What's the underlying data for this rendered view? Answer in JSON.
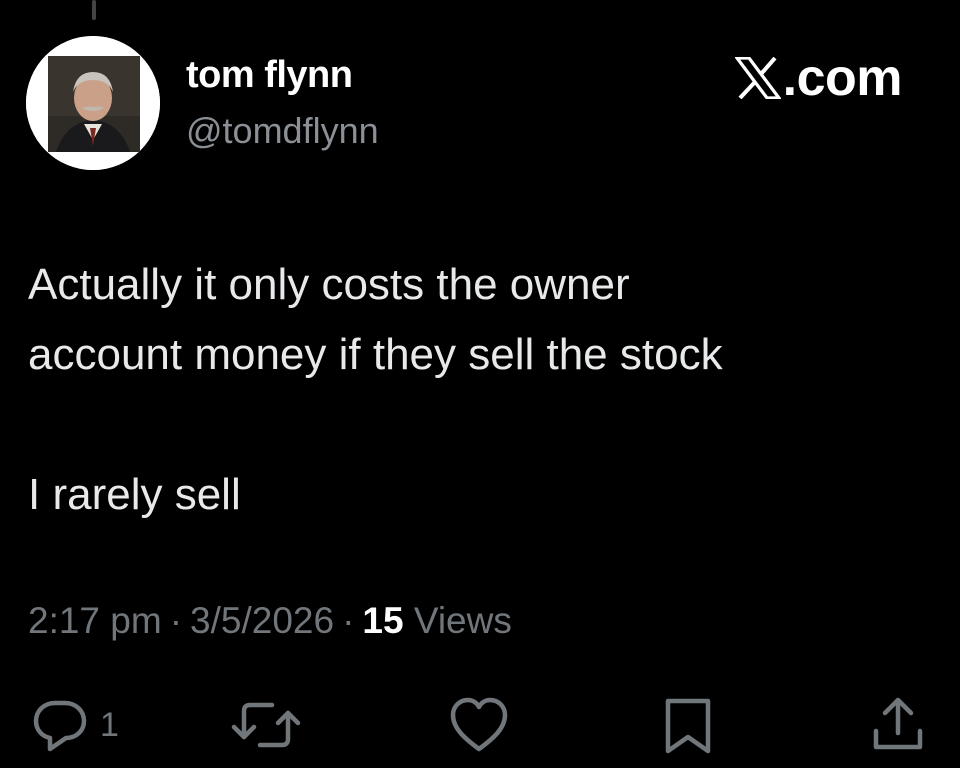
{
  "post": {
    "display_name": "tom flynn",
    "handle": "@tomdflynn",
    "brand": ".com",
    "text_lines": [
      "Actually it only costs the owner",
      "account money if they sell the stock",
      "",
      "I rarely sell"
    ],
    "time": "2:17 pm",
    "separator": "·",
    "date": "3/5/2026",
    "views_count": "15",
    "views_label": "Views"
  },
  "actions": {
    "reply_count": "1",
    "icons": [
      "reply-icon",
      "repost-icon",
      "like-icon",
      "bookmark-icon",
      "share-icon"
    ]
  },
  "colors": {
    "background": "#000000",
    "text": "#e7e9ea",
    "muted": "#71767b"
  }
}
